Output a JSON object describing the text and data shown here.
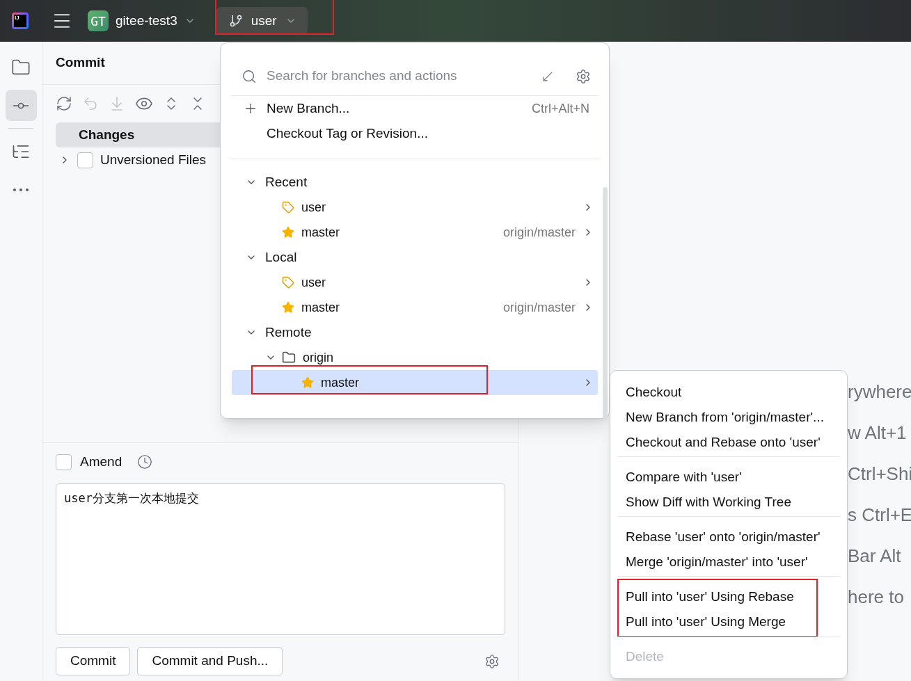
{
  "toolbar": {
    "logo": "IJ",
    "project": {
      "badge": "GT",
      "name": "gitee-test3"
    },
    "branch": {
      "name": "user",
      "highlighted": true
    }
  },
  "tool_strip": [
    {
      "kind": "project",
      "selected": false
    },
    {
      "kind": "commit",
      "selected": true
    },
    {
      "kind": "structure",
      "selected": false
    },
    {
      "kind": "more",
      "selected": false
    }
  ],
  "commit_panel": {
    "title": "Commit",
    "changes": [
      {
        "label": "Changes",
        "selected": true,
        "expandable": false
      },
      {
        "label": "Unversioned Files",
        "selected": false,
        "expandable": true,
        "checked": false
      }
    ],
    "amend": {
      "label": "Amend",
      "checked": false
    },
    "message": "user分支第一次本地提交",
    "buttons": [
      "Commit",
      "Commit and Push..."
    ]
  },
  "background_hints": [
    "rywhere",
    "w Alt+1",
    "Ctrl+Shi",
    "s Ctrl+E",
    "Bar Alt",
    "here to"
  ],
  "branch_popup": {
    "search": {
      "placeholder": "Search for branches and actions"
    },
    "actions": [
      {
        "label": "New Branch...",
        "shortcut": "Ctrl+Alt+N",
        "kind": "add"
      },
      {
        "label": "Checkout Tag or Revision...",
        "kind": "plain"
      }
    ],
    "sections": [
      {
        "label": "Recent",
        "expanded": true,
        "children": [
          {
            "kind": "current",
            "name": "user",
            "selected": false,
            "highlighted": false
          },
          {
            "kind": "favorite",
            "name": "master",
            "tracking": "origin/master",
            "selected": false,
            "highlighted": false
          }
        ]
      },
      {
        "label": "Local",
        "expanded": true,
        "children": [
          {
            "kind": "current",
            "name": "user",
            "selected": false,
            "highlighted": false
          },
          {
            "kind": "favorite",
            "name": "master",
            "tracking": "origin/master",
            "selected": false,
            "highlighted": false
          }
        ]
      },
      {
        "label": "Remote",
        "expanded": true,
        "children": [
          {
            "kind": "folder",
            "name": "origin",
            "expanded": true,
            "children": [
              {
                "kind": "favorite",
                "name": "master",
                "selected": true,
                "highlighted": true
              }
            ]
          }
        ]
      }
    ]
  },
  "context_menu": {
    "groups": [
      {
        "highlighted": false,
        "items": [
          {
            "label": "Checkout",
            "disabled": false
          },
          {
            "label": "New Branch from 'origin/master'...",
            "disabled": false
          },
          {
            "label": "Checkout and Rebase onto 'user'",
            "disabled": false
          }
        ]
      },
      {
        "highlighted": false,
        "items": [
          {
            "label": "Compare with 'user'",
            "disabled": false
          },
          {
            "label": "Show Diff with Working Tree",
            "disabled": false
          }
        ]
      },
      {
        "highlighted": false,
        "items": [
          {
            "label": "Rebase 'user' onto 'origin/master'",
            "disabled": false
          },
          {
            "label": "Merge 'origin/master' into 'user'",
            "disabled": false
          }
        ]
      },
      {
        "highlighted": true,
        "items": [
          {
            "label": "Pull into 'user' Using Rebase",
            "disabled": false
          },
          {
            "label": "Pull into 'user' Using Merge",
            "disabled": false
          }
        ]
      },
      {
        "highlighted": false,
        "items": [
          {
            "label": "Delete",
            "disabled": true
          }
        ]
      }
    ]
  }
}
